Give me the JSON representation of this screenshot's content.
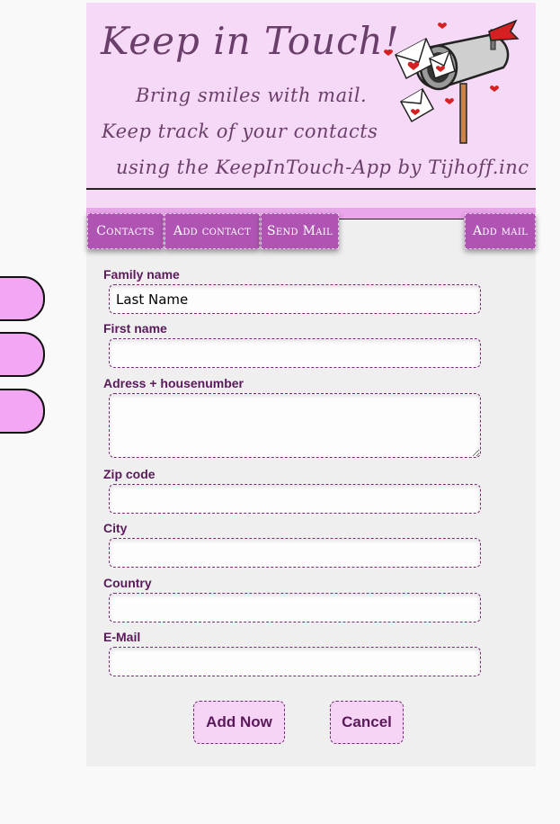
{
  "header": {
    "title": "Keep in Touch!",
    "tagline_1": "Bring smiles with mail.",
    "tagline_2": "Keep track of your contacts",
    "tagline_3": "using the KeepInTouch-App by Tijhoff.inc"
  },
  "nav": {
    "contacts": "Contacts",
    "add_contact": "Add contact",
    "send_mail": "Send Mail",
    "add_mail": "Add mail"
  },
  "form": {
    "family_name": {
      "label": "Family name",
      "value": "Last Name"
    },
    "first_name": {
      "label": "First name",
      "value": ""
    },
    "address": {
      "label": "Adress + housenumber",
      "value": ""
    },
    "zip": {
      "label": "Zip code",
      "value": ""
    },
    "city": {
      "label": "City",
      "value": ""
    },
    "country": {
      "label": "Country",
      "value": ""
    },
    "email": {
      "label": "E-Mail",
      "value": ""
    }
  },
  "actions": {
    "add_now": "Add Now",
    "cancel": "Cancel"
  },
  "colors": {
    "accent": "#b054b4",
    "header_bg": "#f6d9f6",
    "side_tab": "#f3a6f3",
    "label": "#5a1a5a"
  },
  "icons": {
    "mailbox": "mailbox-with-letters-icon"
  }
}
